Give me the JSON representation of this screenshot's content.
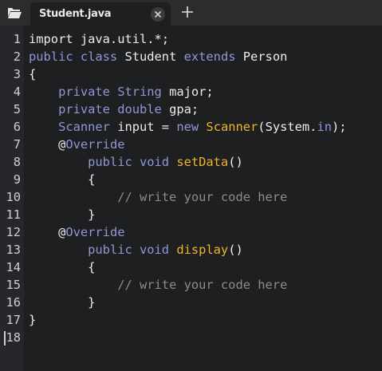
{
  "tabs": [
    {
      "label": "Student.java",
      "close_icon": "close-icon"
    }
  ],
  "toolbar": {
    "folder_icon": "folder-open-icon",
    "add_icon": "plus-icon"
  },
  "editor": {
    "line_numbers": [
      "1",
      "2",
      "3",
      "4",
      "5",
      "6",
      "7",
      "8",
      "9",
      "10",
      "11",
      "12",
      "13",
      "14",
      "15",
      "16",
      "17",
      "18"
    ],
    "lines": [
      [
        {
          "t": "import java.util.*;",
          "c": "pl"
        }
      ],
      [
        {
          "t": "public class ",
          "c": "kw"
        },
        {
          "t": "Student ",
          "c": "pl"
        },
        {
          "t": "extends ",
          "c": "kw"
        },
        {
          "t": "Person",
          "c": "pl"
        }
      ],
      [
        {
          "t": "{",
          "c": "pl"
        }
      ],
      [
        {
          "t": "    private String ",
          "c": "kw"
        },
        {
          "t": "major;",
          "c": "pl"
        }
      ],
      [
        {
          "t": "    private double ",
          "c": "kw"
        },
        {
          "t": "gpa;",
          "c": "pl"
        }
      ],
      [
        {
          "t": "    Scanner ",
          "c": "kw"
        },
        {
          "t": "input = ",
          "c": "pl"
        },
        {
          "t": "new ",
          "c": "kw"
        },
        {
          "t": "Scanner",
          "c": "fn"
        },
        {
          "t": "(System.",
          "c": "pl"
        },
        {
          "t": "in",
          "c": "kw"
        },
        {
          "t": ");",
          "c": "pl"
        }
      ],
      [
        {
          "t": "    @",
          "c": "pl"
        },
        {
          "t": "Override",
          "c": "kw"
        }
      ],
      [
        {
          "t": "        public void ",
          "c": "kw"
        },
        {
          "t": "setData",
          "c": "fn"
        },
        {
          "t": "()",
          "c": "pl"
        }
      ],
      [
        {
          "t": "        {",
          "c": "pl"
        }
      ],
      [
        {
          "t": "            // write your code here",
          "c": "cm"
        }
      ],
      [
        {
          "t": "        }",
          "c": "pl"
        }
      ],
      [
        {
          "t": "    @",
          "c": "pl"
        },
        {
          "t": "Override",
          "c": "kw"
        }
      ],
      [
        {
          "t": "        public void ",
          "c": "kw"
        },
        {
          "t": "display",
          "c": "fn"
        },
        {
          "t": "()",
          "c": "pl"
        }
      ],
      [
        {
          "t": "        {",
          "c": "pl"
        }
      ],
      [
        {
          "t": "            // write your code here",
          "c": "cm"
        }
      ],
      [
        {
          "t": "        }",
          "c": "pl"
        }
      ],
      [
        {
          "t": "}",
          "c": "pl"
        }
      ],
      []
    ]
  },
  "colors": {
    "background": "#1e1f20",
    "keyword": "#8f97d8",
    "plain": "#ececec",
    "function": "#f0b429",
    "comment": "#8c8c8c"
  }
}
